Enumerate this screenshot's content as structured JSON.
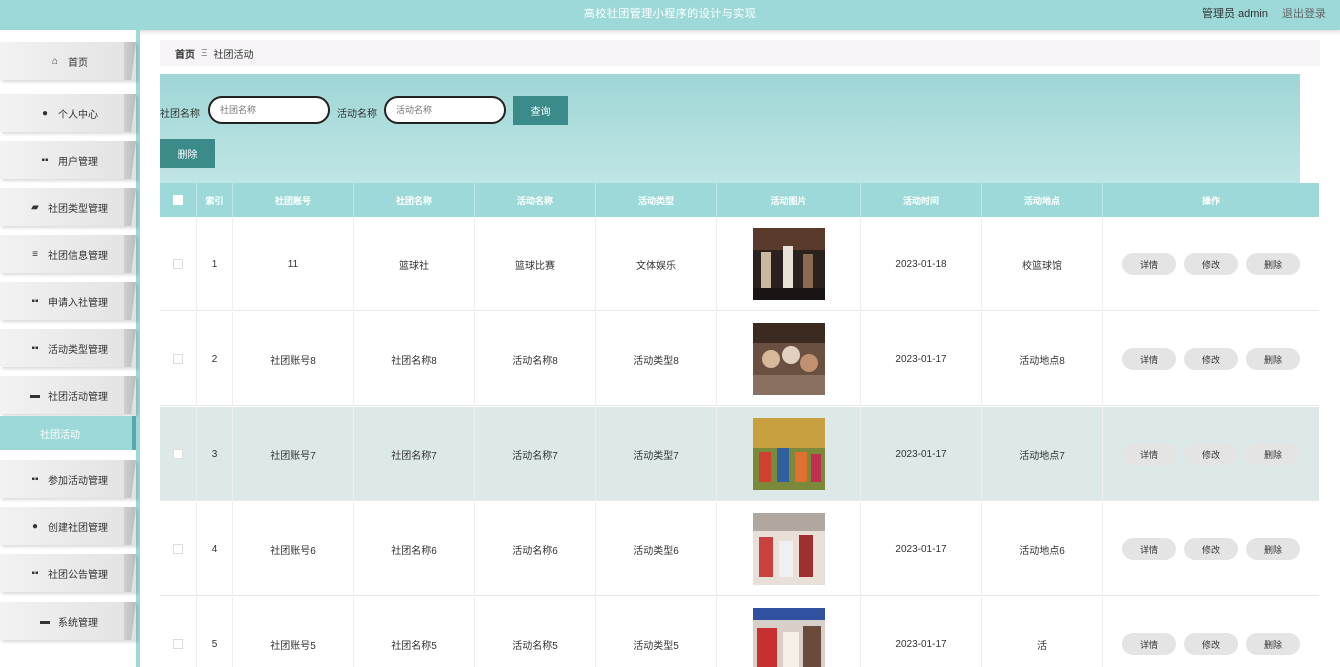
{
  "header": {
    "title": "高校社团管理小程序的设计与实现",
    "user": "管理员 admin",
    "logout": "退出登录"
  },
  "sidebar": {
    "items": [
      {
        "label": "首页",
        "icon": "home-icon",
        "glyph": "⌂"
      },
      {
        "label": "个人中心",
        "icon": "user-icon",
        "glyph": "●"
      },
      {
        "label": "用户管理",
        "icon": "grid-icon",
        "glyph": "▪▪"
      },
      {
        "label": "社团类型管理",
        "icon": "folder-icon",
        "glyph": "▰"
      },
      {
        "label": "社团信息管理",
        "icon": "list-icon",
        "glyph": "≡"
      },
      {
        "label": "申请入社管理",
        "icon": "grid-icon",
        "glyph": "▪▪"
      },
      {
        "label": "活动类型管理",
        "icon": "grid-icon",
        "glyph": "▪▪"
      },
      {
        "label": "社团活动管理",
        "icon": "briefcase-icon",
        "glyph": "▬"
      }
    ],
    "active_sub": "社团活动",
    "items_after": [
      {
        "label": "参加活动管理",
        "icon": "grid-icon",
        "glyph": "▪▪"
      },
      {
        "label": "创建社团管理",
        "icon": "bulb-icon",
        "glyph": "●"
      },
      {
        "label": "社团公告管理",
        "icon": "grid-icon",
        "glyph": "▪▪"
      },
      {
        "label": "系统管理",
        "icon": "monitor-icon",
        "glyph": "▬"
      }
    ]
  },
  "breadcrumb": {
    "home": "首页",
    "sep": "Ξ",
    "current": "社团活动"
  },
  "filters": {
    "club_name_label": "社团名称",
    "club_name_placeholder": "社团名称",
    "activity_name_label": "活动名称",
    "activity_name_placeholder": "活动名称",
    "query_button": "查询",
    "delete_button": "删除"
  },
  "table": {
    "headers": [
      "",
      "索引",
      "社团账号",
      "社团名称",
      "活动名称",
      "活动类型",
      "活动图片",
      "活动时间",
      "活动地点",
      "操作"
    ],
    "actions": {
      "detail": "详情",
      "edit": "修改",
      "delete": "删除"
    },
    "rows": [
      {
        "index": "1",
        "account": "11",
        "club": "篮球社",
        "activity": "篮球比赛",
        "type": "文体娱乐",
        "time": "2023-01-18",
        "place": "校篮球馆"
      },
      {
        "index": "2",
        "account": "社团账号8",
        "club": "社团名称8",
        "activity": "活动名称8",
        "type": "活动类型8",
        "time": "2023-01-17",
        "place": "活动地点8"
      },
      {
        "index": "3",
        "account": "社团账号7",
        "club": "社团名称7",
        "activity": "活动名称7",
        "type": "活动类型7",
        "time": "2023-01-17",
        "place": "活动地点7"
      },
      {
        "index": "4",
        "account": "社团账号6",
        "club": "社团名称6",
        "activity": "活动名称6",
        "type": "活动类型6",
        "time": "2023-01-17",
        "place": "活动地点6"
      },
      {
        "index": "5",
        "account": "社团账号5",
        "club": "社团名称5",
        "activity": "活动名称5",
        "type": "活动类型5",
        "time": "2023-01-17",
        "place": "活"
      }
    ]
  },
  "colors": {
    "accent": "#9dd9d9",
    "button": "#3c8b8b",
    "highlight_row": "#dde9e9"
  }
}
